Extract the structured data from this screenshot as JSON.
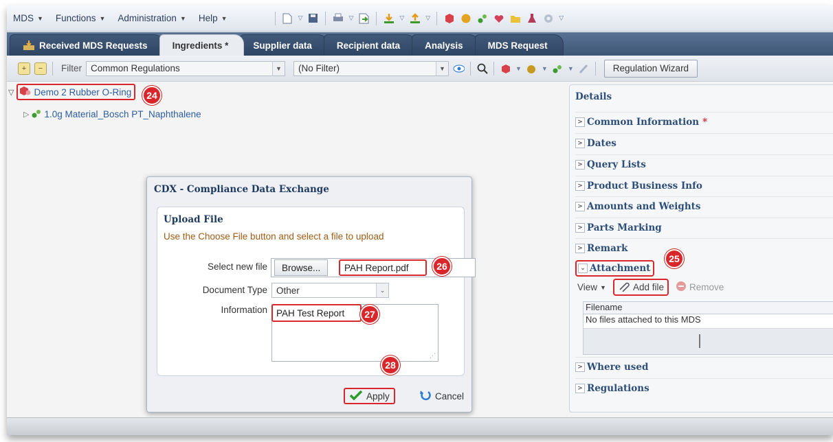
{
  "menu": {
    "items": [
      "MDS",
      "Functions",
      "Administration",
      "Help"
    ],
    "toolbar_icons": [
      "new-document-icon",
      "save-icon",
      "print-icon",
      "export-icon",
      "download-icon",
      "upload-icon",
      "cube-icon",
      "globe-icon",
      "components-icon",
      "heart-icon",
      "folder-icon",
      "flask-icon",
      "settings-icon"
    ]
  },
  "tabs": [
    "Received MDS Requests",
    "Ingredients *",
    "Supplier data",
    "Recipient data",
    "Analysis",
    "MDS Request"
  ],
  "toolbar": {
    "filter_label": "Filter",
    "filter_value": "Common Regulations",
    "second_filter_value": "(No Filter)",
    "wizard_label": "Regulation Wizard"
  },
  "tree": {
    "root_label": "Demo 2 Rubber O-Ring",
    "child_label": "1.0g Material_Bosch PT_Naphthalene"
  },
  "details": {
    "title": "Details",
    "sections": [
      "Common Information",
      "Dates",
      "Query Lists",
      "Product Business Info",
      "Amounts and Weights",
      "Parts Marking",
      "Remark",
      "Attachment",
      "Where used",
      "Regulations"
    ],
    "attachment": {
      "view_label": "View",
      "add_label": "Add file",
      "remove_label": "Remove",
      "column_filename": "Filename",
      "empty_message": "No files attached to this MDS"
    }
  },
  "dialog": {
    "title": "CDX - Compliance Data Exchange",
    "upload_title": "Upload File",
    "upload_hint": "Use the Choose File button and select a file to upload",
    "select_file_label": "Select new file",
    "browse_label": "Browse...",
    "file_value": "PAH Report.pdf",
    "doc_type_label": "Document Type",
    "doc_type_value": "Other",
    "information_label": "Information",
    "information_value": "PAH Test Report",
    "apply_label": "Apply",
    "cancel_label": "Cancel"
  },
  "callouts": [
    "24",
    "25",
    "26",
    "27",
    "28"
  ],
  "colors": {
    "accent_red": "#d8262a",
    "tab_blue": "#3f5878",
    "link_blue": "#2c5ea3"
  }
}
